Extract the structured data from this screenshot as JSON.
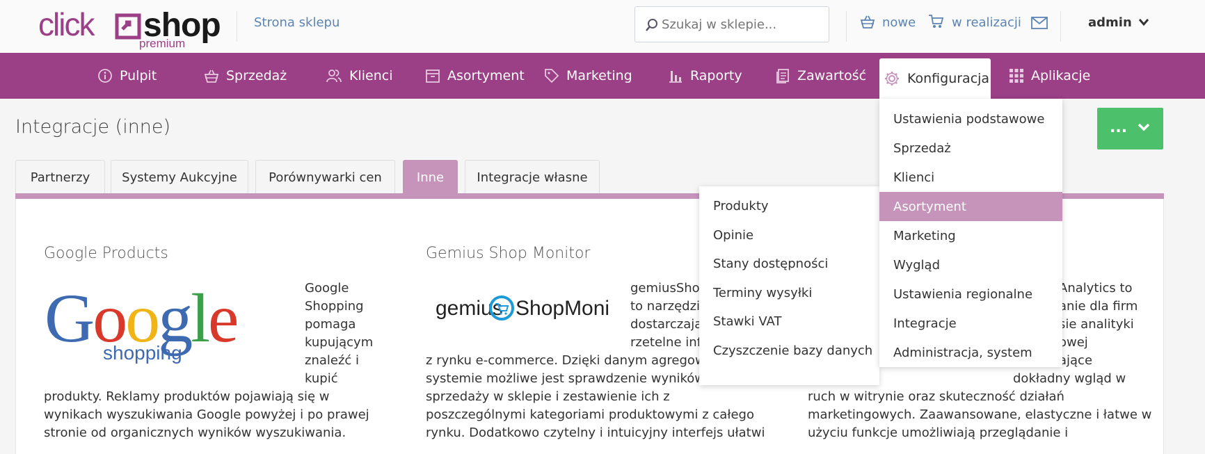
{
  "header": {
    "logo": {
      "click": "click",
      "shop": "shop",
      "premium": "premium"
    },
    "store_link": "Strona sklepu",
    "search_placeholder": "Szukaj w sklepie...",
    "orders_new": "nowe",
    "orders_in_progress": "w realizacji",
    "user": "admin"
  },
  "nav": {
    "items": [
      {
        "label": "Pulpit",
        "icon": "info-icon"
      },
      {
        "label": "Sprzedaż",
        "icon": "basket-icon"
      },
      {
        "label": "Klienci",
        "icon": "users-icon"
      },
      {
        "label": "Asortyment",
        "icon": "box-icon"
      },
      {
        "label": "Marketing",
        "icon": "tag-icon"
      },
      {
        "label": "Raporty",
        "icon": "bar-chart-icon"
      },
      {
        "label": "Zawartość",
        "icon": "documents-icon"
      },
      {
        "label": "Konfiguracja",
        "icon": "gear-icon"
      },
      {
        "label": "Aplikacje",
        "icon": "grid-icon"
      }
    ]
  },
  "page": {
    "title": "Integracje (inne)",
    "action_label": "..."
  },
  "tabs": [
    "Partnerzy",
    "Systemy Aukcyjne",
    "Porównywarki cen",
    "Inne",
    "Integracje własne"
  ],
  "active_tab": "Inne",
  "config_menu": {
    "items": [
      "Ustawienia podstawowe",
      "Sprzedaż",
      "Klienci",
      "Asortyment",
      "Marketing",
      "Wygląd",
      "Ustawienia regionalne",
      "Integracje",
      "Administracja, system"
    ],
    "highlighted": "Asortyment"
  },
  "submenu": {
    "items": [
      "Produkty",
      "Opinie",
      "Stany dostępności",
      "Terminy wysyłki",
      "Stawki VAT",
      "Czyszczenie bazy danych"
    ]
  },
  "cards": {
    "google": {
      "title": "Google Products",
      "logo_text": "Google",
      "logo_sub": "shopping",
      "side_lines": [
        "Google",
        "Shopping",
        "pomaga",
        "kupującym",
        "znaleźć i",
        "kupić"
      ],
      "lines": [
        "produkty. Reklamy produktów pojawiają się w",
        "wynikach wyszukiwania Google powyżej i po prawej",
        "stronie od organicznych wyników wyszukiwania."
      ]
    },
    "gemius": {
      "title": "Gemius Shop Monitor",
      "logo_text_1": "gemius",
      "logo_text_2": "ShopMonitor",
      "side_lines": [
        "gemiusShop",
        "to narzędzi",
        "dostarczają",
        "rzetelne inf"
      ],
      "lines": [
        "z rynku e-commerce. Dzięki danym agregowa",
        "systemie możliwe jest sprawdzenie wyników",
        "sprzedaży w sklepie i zestawienie ich z",
        "poszczególnymi kategoriami produktowymi z całego",
        "rynku. Dodatkowo czytelny i intuicyjny interfejs ułatwi"
      ]
    },
    "analytics": {
      "side_lines": [
        "Analytics to",
        "anie dla firm",
        "sie analityki",
        "owej",
        "ające",
        "dokładny wgląd w"
      ],
      "lines": [
        "ruch w witrynie oraz skuteczność działań",
        "marketingowych. Zaawansowane, elastyczne i łatwe w",
        "użyciu funkcje umożliwiają przeglądanie i"
      ]
    }
  },
  "colors": {
    "brand": "#9b3f86",
    "tab_active": "#c694bb",
    "action": "#4cc06a",
    "link": "#5a84b4"
  }
}
